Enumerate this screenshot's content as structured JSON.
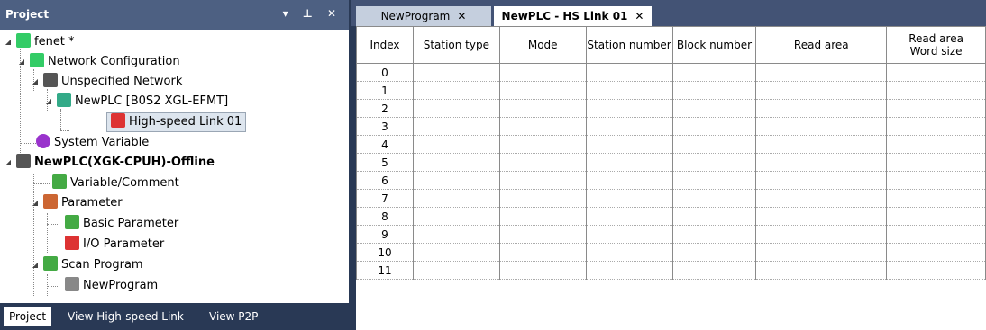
{
  "project_pane": {
    "title": "Project",
    "buttons": "▾ ⊥ ✕",
    "tree": [
      {
        "label": "fenet *",
        "icon": "network-icon",
        "color": "#3c6"
      },
      {
        "label": "Network Configuration",
        "icon": "network-icon",
        "color": "#3c6"
      },
      {
        "label": "Unspecified Network",
        "icon": "plc-module-icon",
        "color": "#444"
      },
      {
        "label": "NewPLC [B0S2 XGL-EFMT]",
        "icon": "station-icon",
        "color": "#3a8"
      },
      {
        "label": "High-speed Link 01",
        "icon": "link-icon",
        "color": "#d33"
      },
      {
        "label": "System Variable",
        "icon": "system-variable-icon",
        "color": "#93c"
      },
      {
        "label": "NewPLC(XGK-CPUH)-Offline",
        "icon": "plc-module-icon",
        "color": "#444"
      },
      {
        "label": "Variable/Comment",
        "icon": "variable-icon",
        "color": "#4a4"
      },
      {
        "label": "Parameter",
        "icon": "parameter-icon",
        "color": "#c63"
      },
      {
        "label": "Basic Parameter",
        "icon": "basic-parameter-icon",
        "color": "#4a4"
      },
      {
        "label": "I/O Parameter",
        "icon": "io-parameter-icon",
        "color": "#d33"
      },
      {
        "label": "Scan Program",
        "icon": "scan-program-icon",
        "color": "#4a4"
      },
      {
        "label": "NewProgram",
        "icon": "program-icon",
        "color": "#888"
      }
    ],
    "tabs": [
      "Project",
      "View High-speed Link",
      "View P2P"
    ]
  },
  "doc_tabs": [
    {
      "label": "NewProgram",
      "close": "✕"
    },
    {
      "label": "NewPLC - HS Link 01",
      "close": "✕"
    }
  ],
  "grid": {
    "headers": [
      "Index",
      "Station type",
      "Mode",
      "Station number",
      "Block number",
      "Read area",
      "Read area\nWord size"
    ],
    "rows": [
      "0",
      "1",
      "2",
      "3",
      "4",
      "5",
      "6",
      "7",
      "8",
      "9",
      "10",
      "11"
    ]
  }
}
